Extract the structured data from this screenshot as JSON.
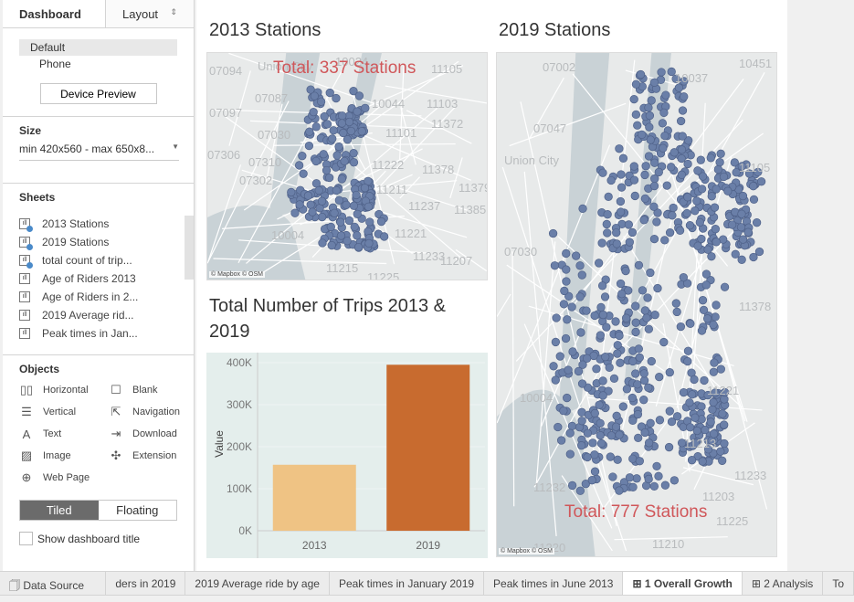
{
  "sidebar": {
    "tabs": [
      "Dashboard",
      "Layout"
    ],
    "device": {
      "items": [
        "Default",
        "Phone"
      ],
      "preview_button": "Device Preview"
    },
    "size": {
      "heading": "Size",
      "value": "min 420x560 - max 650x8..."
    },
    "sheets": {
      "heading": "Sheets",
      "items": [
        {
          "label": "2013 Stations",
          "used": true
        },
        {
          "label": "2019 Stations",
          "used": true
        },
        {
          "label": "total count of trip...",
          "used": true
        },
        {
          "label": "Age of Riders 2013",
          "used": false
        },
        {
          "label": "Age of Riders in 2...",
          "used": false
        },
        {
          "label": "2019 Average rid...",
          "used": false
        },
        {
          "label": "Peak times in Jan...",
          "used": false
        }
      ]
    },
    "objects": {
      "heading": "Objects",
      "items": [
        {
          "label": "Horizontal",
          "icon": "horizontal-container-icon"
        },
        {
          "label": "Blank",
          "icon": "blank-icon"
        },
        {
          "label": "Vertical",
          "icon": "vertical-container-icon"
        },
        {
          "label": "Navigation",
          "icon": "navigation-icon"
        },
        {
          "label": "Text",
          "icon": "text-icon"
        },
        {
          "label": "Download",
          "icon": "download-icon"
        },
        {
          "label": "Image",
          "icon": "image-icon"
        },
        {
          "label": "Extension",
          "icon": "extension-icon"
        },
        {
          "label": "Web Page",
          "icon": "globe-icon"
        }
      ]
    },
    "layout_mode": {
      "options": [
        "Tiled",
        "Floating"
      ],
      "selected": "Tiled"
    },
    "show_title": {
      "label": "Show dashboard title",
      "checked": false
    }
  },
  "dashboard": {
    "map2013": {
      "title": "2013 Stations",
      "total": "Total: 337 Stations",
      "attribution": "© Mapbox © OSM",
      "labels": [
        "07094",
        "Union City",
        "10024",
        "11105",
        "07087",
        "10044",
        "11103",
        "07097",
        "11372",
        "07030",
        "11101",
        "07306",
        "07310",
        "11222",
        "11378",
        "07302",
        "11211",
        "11379",
        "11237",
        "11385",
        "10004",
        "11221",
        "11233",
        "11207",
        "11215",
        "11225"
      ]
    },
    "map2019": {
      "title": "2019 Stations",
      "total": "Total: 777 Stations",
      "attribution": "© Mapbox © OSM",
      "labels": [
        "07002",
        "10451",
        "10037",
        "07047",
        "Union City",
        "11105",
        "07030",
        "11378",
        "10004",
        "11221",
        "11213",
        "11232",
        "11203",
        "11220",
        "11210",
        "11233",
        "11225"
      ]
    },
    "chart_title": "Total Number of Trips 2013 & 2019",
    "dot_color": "#6a7fa8"
  },
  "chart_data": {
    "type": "bar",
    "title": "Total Number of Trips 2013 & 2019",
    "categories": [
      "2013",
      "2019"
    ],
    "values": [
      157000,
      395000
    ],
    "ylabel": "Value",
    "xlabel": "",
    "ylim": [
      0,
      400000
    ],
    "yticks": [
      "0K",
      "100K",
      "200K",
      "300K",
      "400K"
    ],
    "colors": [
      "#efc384",
      "#c86b2f"
    ],
    "background": "#e4eeec",
    "grid": true
  },
  "tabs": [
    "Data Source",
    "ders in 2019",
    "2019 Average ride by age",
    "Peak times in January 2019",
    "Peak times in June 2013",
    "1 Overall Growth",
    "2 Analysis",
    "To"
  ],
  "active_tab": "1 Overall Growth"
}
